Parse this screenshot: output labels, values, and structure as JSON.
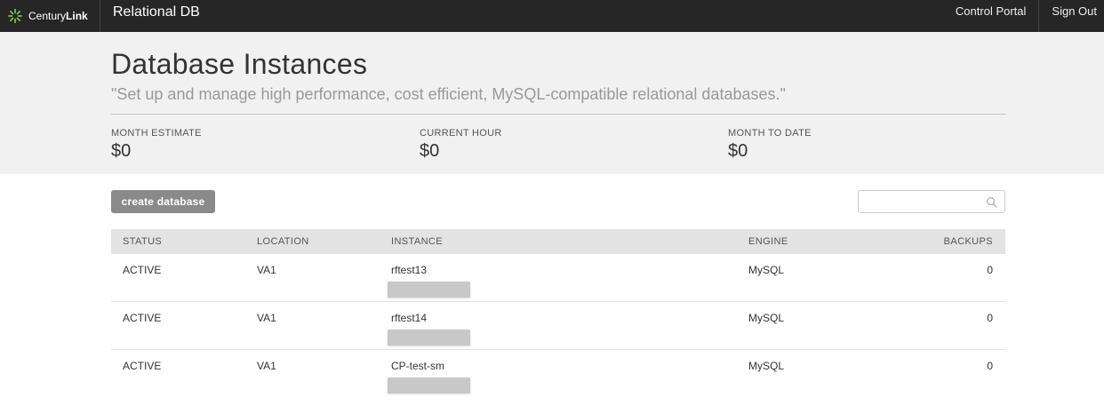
{
  "app": {
    "brand_light": "Century",
    "brand_bold": "Link",
    "title": "Relational DB"
  },
  "nav": {
    "control_portal": "Control Portal",
    "sign_out": "Sign Out"
  },
  "hero": {
    "title": "Database Instances",
    "subtitle": "\"Set up and manage high performance, cost efficient, MySQL-compatible relational databases.\"",
    "stats": [
      {
        "label": "MONTH ESTIMATE",
        "value": "$0"
      },
      {
        "label": "CURRENT HOUR",
        "value": "$0"
      },
      {
        "label": "MONTH TO DATE",
        "value": "$0"
      }
    ]
  },
  "toolbar": {
    "create_label": "create database",
    "search_placeholder": "",
    "search_icon": "search-icon"
  },
  "table": {
    "headers": {
      "status": "STATUS",
      "location": "LOCATION",
      "instance": "INSTANCE",
      "engine": "ENGINE",
      "backups": "BACKUPS"
    },
    "rows": [
      {
        "status": "ACTIVE",
        "location": "VA1",
        "instance": "rftest13",
        "engine": "MySQL",
        "backups": "0"
      },
      {
        "status": "ACTIVE",
        "location": "VA1",
        "instance": "rftest14",
        "engine": "MySQL",
        "backups": "0"
      },
      {
        "status": "ACTIVE",
        "location": "VA1",
        "instance": "CP-test-sm",
        "engine": "MySQL",
        "backups": "0"
      }
    ]
  },
  "colors": {
    "topbar": "#262626",
    "hero_bg": "#f1f1f1",
    "button": "#8a8a8a",
    "brand_green": "#7ac143"
  }
}
